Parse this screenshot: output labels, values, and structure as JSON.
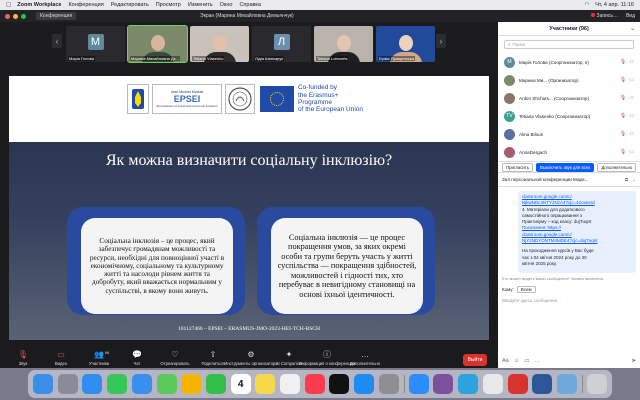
{
  "menubar": {
    "app": "Zoom Workplace",
    "items": [
      "Конференция",
      "Редактировать",
      "Просмотр",
      "Изменить",
      "Окно",
      "Справка"
    ],
    "datetime": "Чт, 4 апр.  11:16"
  },
  "titlebar": {
    "tag": "Конференция",
    "title": "Экран (Марина Михайловна Демьянчук)",
    "recording": "Запись…",
    "view": "Вид"
  },
  "tiles": [
    {
      "name": "Марія Голова",
      "initial": "М",
      "type": "initial",
      "bg": "#5e8a9a"
    },
    {
      "name": "Марина Михайловна Дє...",
      "type": "photo",
      "bg": "#7b8a6a",
      "skin": "#d9b49a",
      "cloth": "#3b4a3a",
      "active": true
    },
    {
      "name": "Tetiana Vlasenko",
      "type": "photo",
      "bg": "#c8c2bb",
      "skin": "#e3c0a8",
      "cloth": "#2d2a28"
    },
    {
      "name": "Лідія Шинкарук",
      "initial": "Л",
      "type": "initial",
      "bg": "#6c8fb0"
    },
    {
      "name": "Tetiana Lobunets",
      "type": "photo",
      "bg": "#b9b3ab",
      "skin": "#e5c6ad",
      "cloth": "#1f1f22"
    },
    {
      "name": "Ерікія Прищепська",
      "type": "photo",
      "bg": "#224a9a",
      "skin": "#efd2bb",
      "cloth": "#cfa88a"
    }
  ],
  "slide": {
    "logo_text": "EPSEI",
    "logo_sub": "EU practices of social and economic inclusion",
    "logo_school": "Jean Monnet Module",
    "eu_line1": "Co-funded by",
    "eu_line2": "the Erasmus+ Programme",
    "eu_line3": "of the European Union",
    "title": "Як можна визначити соціальну інклюзію?",
    "card_left": "Соціальна інклюзія – це процес, який забезпечує громадянам можливості та ресурси, необхідні для повноцінної участі в економічному, соціальному та культурному житті та насолоди рівнем життя та добробуту, який вважається нормальним у суспільстві, в якому вони живуть.",
    "card_right": "Соціальна інклюзія — це процес покращення умов, за яких окремі особи та групи беруть участь у житті суспільства — покращення здібностей, можливостей і гідності тих, хто перебуває в невигідному становищі на основі їхньої ідентичності.",
    "footer": "101127466 – EPSEI – ERASMUS-JMO-2023-HEI-TCH-RSCH"
  },
  "toolbar": [
    {
      "label": "Звук",
      "icon": "microphone-muted-icon"
    },
    {
      "label": "Видео",
      "icon": "camera-off-icon"
    },
    {
      "label": "Участники",
      "icon": "participants-icon",
      "badge": "96"
    },
    {
      "label": "Чат",
      "icon": "chat-icon"
    },
    {
      "label": "Отреагировать",
      "icon": "react-icon"
    },
    {
      "label": "Поделиться",
      "icon": "share-icon"
    },
    {
      "label": "Инструменты организатора",
      "icon": "host-tools-icon"
    },
    {
      "label": "AI Companion",
      "icon": "ai-companion-icon"
    },
    {
      "label": "Информация о конференции",
      "icon": "info-icon"
    },
    {
      "label": "Дополнительно",
      "icon": "more-icon"
    }
  ],
  "end_label": "Выйти",
  "participants_panel": {
    "title": "Участники (96)",
    "search_placeholder": "Поиск",
    "people": [
      {
        "name": "Марія Голова  (Соорганизатор, я)",
        "initial": "М",
        "color": "#5e8a9a"
      },
      {
        "name": "Марина Ми...  (Организатор)",
        "initial": "",
        "color": "#7b8a6a"
      },
      {
        "name": "Anton Shchuts...  (Соорганизатор)",
        "initial": "",
        "color": "#8a7766"
      },
      {
        "name": "Tetiana Vlasenko  (Соорганизатор)",
        "initial": "TV",
        "color": "#3aa38f"
      },
      {
        "name": "Alina Bilous",
        "initial": "",
        "color": "#5a6ea8"
      },
      {
        "name": "AnnaDergach",
        "initial": "",
        "color": "#a85a6e"
      }
    ],
    "invite": "Пригласить",
    "mute_all": "Выключить звук для всех",
    "more": "Дополнительно"
  },
  "chat": {
    "title": "Зал персональной конференции Мари...",
    "lines": [
      "classroom.google.com/c/",
      "NjkwNDc4NTY2NzA4?cjc=42oxesrd",
      "4. Матеріали для додаткового",
      "самостійного опрацювання з",
      "Практикуму – код класу: dujTuqnt",
      "Посилання: https://",
      "classroom.google.com/c/",
      "NjY2NDYONTM4MDE4?cjc=dujTuqnt",
      "",
      "На проходження курсів у Вас буде",
      "час з 04 квітня 2024 року до 30",
      "квітня 2025 року."
    ],
    "meta": "Кто может видеть ваши сообщения? Запись включена",
    "to_label": "Кому:",
    "to_value": "Всем",
    "input_placeholder": "Введите здесь сообщение..."
  },
  "dock": [
    "finder",
    "launchpad",
    "safari",
    "messages",
    "mail",
    "maps",
    "photos",
    "facetime",
    "calendar",
    "notes",
    "freeform",
    "music",
    "tv",
    "appstore",
    "settings",
    "zoom",
    "viber",
    "telegram",
    "chrome",
    "acrobat",
    "word",
    "preview",
    "trash"
  ],
  "dock_calendar_day": "4"
}
